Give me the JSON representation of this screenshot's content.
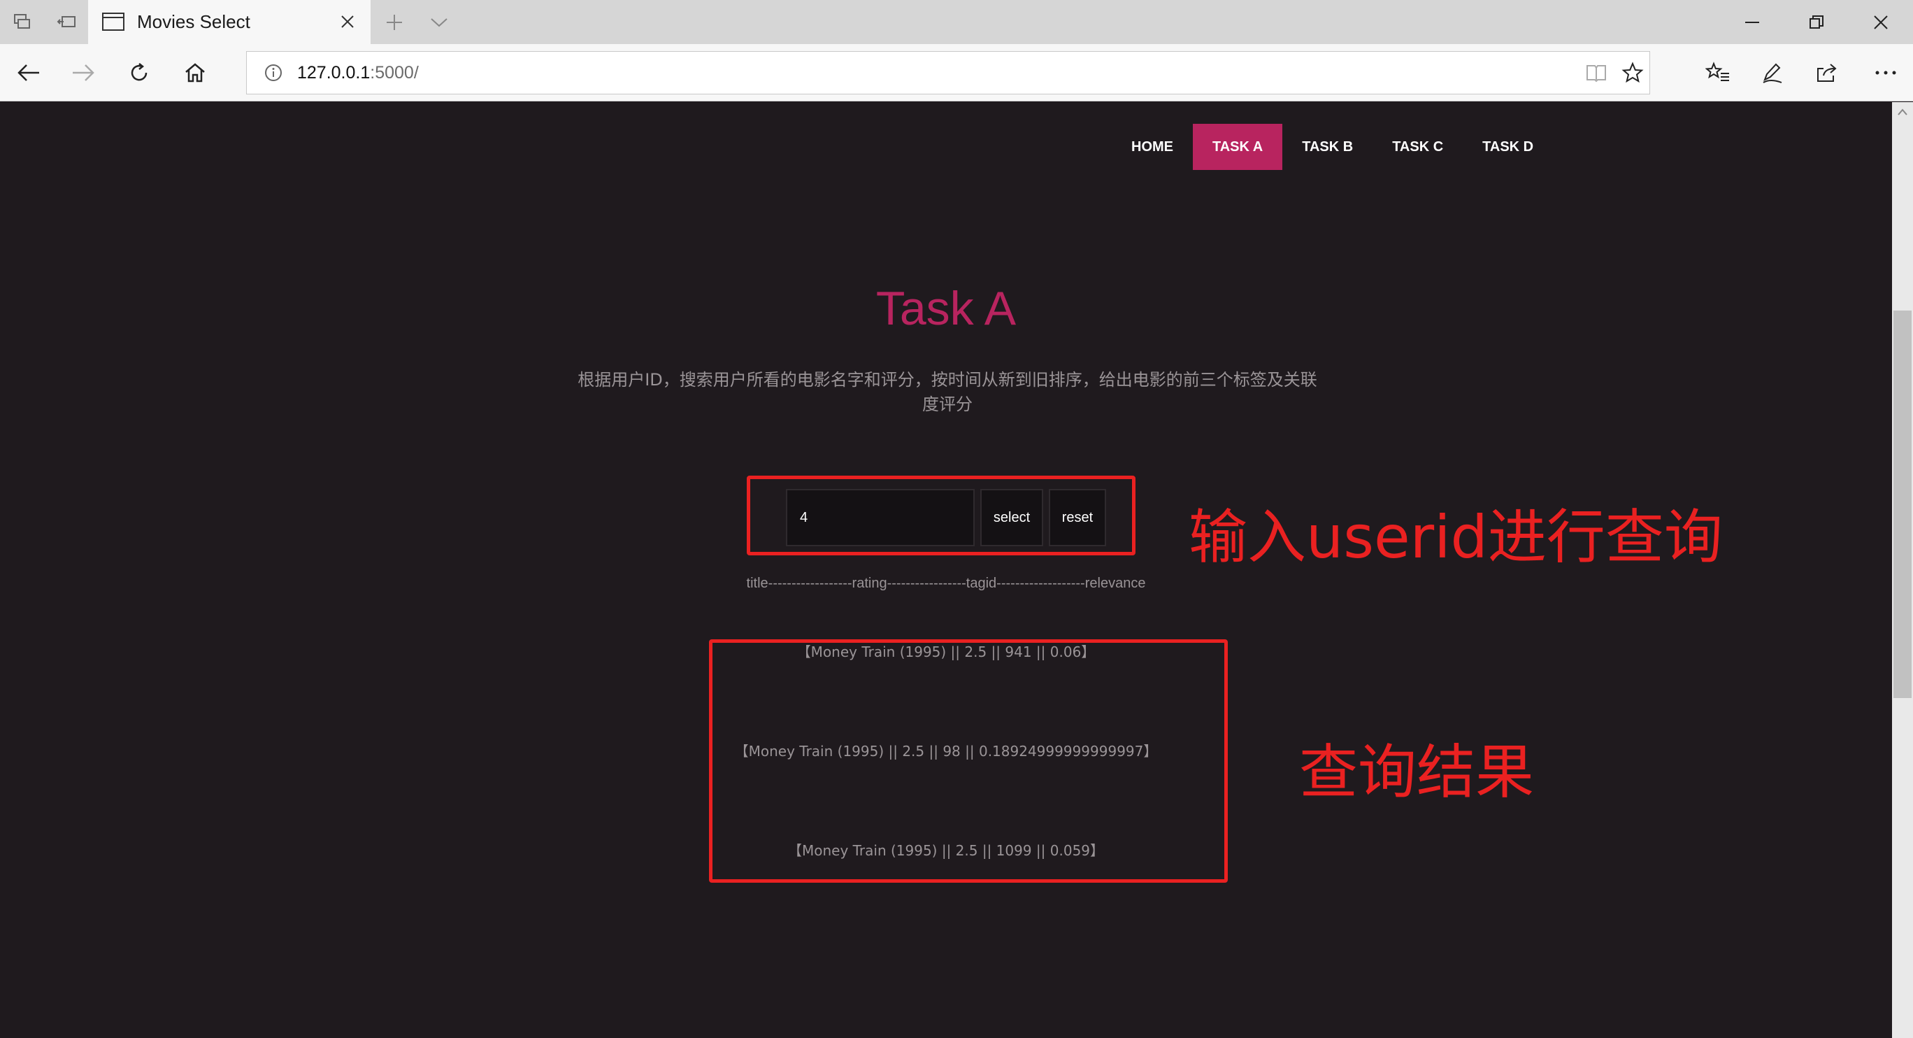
{
  "browser": {
    "tab_title": "Movies Select",
    "url_host": "127.0.0.1",
    "url_path": ":5000/"
  },
  "nav": {
    "items": [
      {
        "label": "HOME",
        "active": false
      },
      {
        "label": "TASK A",
        "active": true
      },
      {
        "label": "TASK B",
        "active": false
      },
      {
        "label": "TASK C",
        "active": false
      },
      {
        "label": "TASK D",
        "active": false
      }
    ]
  },
  "main": {
    "title": "Task A",
    "description": "根据用户ID，搜索用户所看的电影名字和评分，按时间从新到旧排序，给出电影的前三个标签及关联度评分",
    "search": {
      "value": "4",
      "select_label": "select",
      "reset_label": "reset"
    },
    "result_header": "title------------------rating-----------------tagid-------------------relevance",
    "results": [
      "【Money Train (1995) || 2.5 || 941 || 0.06】",
      "【Money Train (1995) || 2.5 || 98 || 0.18924999999999997】",
      "【Money Train (1995) || 2.5 || 1099 || 0.059】"
    ]
  },
  "annotations": {
    "input_note": "输入userid进行查询",
    "result_note": "查询结果"
  },
  "colors": {
    "accent": "#b8245f",
    "page_bg": "#1f1a1e",
    "annotation": "#ea2121"
  }
}
